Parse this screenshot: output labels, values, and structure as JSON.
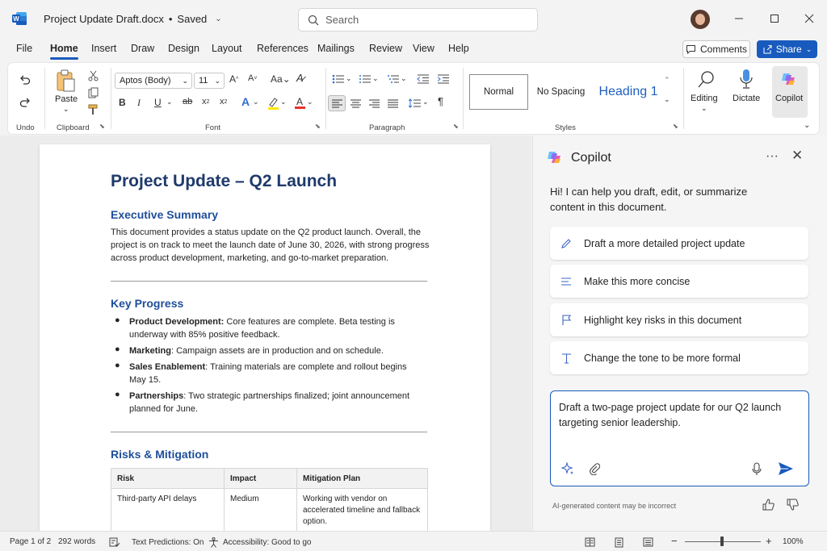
{
  "titlebar": {
    "doc_name": "Project Update Draft.docx",
    "separator": "•",
    "save_state": "Saved",
    "search_placeholder": "Search",
    "word_icon_color": "#185abd"
  },
  "tabs": [
    "File",
    "Home",
    "Insert",
    "Draw",
    "Design",
    "Layout",
    "References",
    "Mailings",
    "Review",
    "View",
    "Help"
  ],
  "active_tab": "Home",
  "actions": {
    "comments": "Comments",
    "share": "Share"
  },
  "ribbon": {
    "groups": {
      "undo": "Undo",
      "clipboard": "Clipboard",
      "font": "Font",
      "paragraph": "Paragraph",
      "styles": "Styles"
    },
    "paste_label": "Paste",
    "font_name": "Aptos (Body)",
    "font_size": "11",
    "styles": {
      "normal": "Normal",
      "no_spacing": "No Spacing",
      "heading1": "Heading 1"
    },
    "editing_label": "Editing",
    "dictate_label": "Dictate",
    "copilot_label": "Copilot",
    "accent_color": "#185abd"
  },
  "document": {
    "title": "Project Update – Q2 Launch",
    "exec_heading": "Executive Summary",
    "exec_body": "This document provides a status update on the Q2 product launch. Overall, the project is on track to meet the launch date of June 30, 2026, with strong progress across product development, marketing, and go-to-market preparation.",
    "progress_heading": "Key Progress",
    "bullets": [
      {
        "label": "Product Development:",
        "text": " Core features are complete. Beta testing is underway with 85% positive feedback."
      },
      {
        "label": "Marketing",
        "text": ": Campaign assets are in production and on schedule."
      },
      {
        "label": "Sales Enablement",
        "text": ": Training materials are complete and rollout begins May 15."
      },
      {
        "label": "Partnerships",
        "text": ": Two strategic partnerships finalized; joint announcement planned for June."
      }
    ],
    "risks_heading": "Risks & Mitigation",
    "table": {
      "headers": [
        "Risk",
        "Impact",
        "Mitigation Plan"
      ],
      "rows": [
        [
          "Third-party API delays",
          "Medium",
          "Working with vendor on accelerated timeline and fallback option."
        ]
      ]
    }
  },
  "copilot": {
    "title": "Copilot",
    "greeting": "Hi! I can help you draft, edit, or summarize content in this document.",
    "suggestions": [
      {
        "icon": "pencil-icon",
        "label": "Draft a more detailed project update"
      },
      {
        "icon": "lines-icon",
        "label": "Make this more concise"
      },
      {
        "icon": "flag-icon",
        "label": "Highlight key risks in this document"
      },
      {
        "icon": "text-icon",
        "label": "Change the tone to be more formal"
      }
    ],
    "prompt": "Draft a two-page project update for our Q2 launch targeting senior leadership.",
    "disclaimer": "AI-generated content may be incorrect"
  },
  "status": {
    "page": "Page 1 of 2",
    "words": "292 words",
    "predictions": "Text Predictions: On",
    "accessibility": "Accessibility: Good to go",
    "zoom_minus": "−",
    "zoom_plus": "+",
    "zoom": "100%"
  }
}
